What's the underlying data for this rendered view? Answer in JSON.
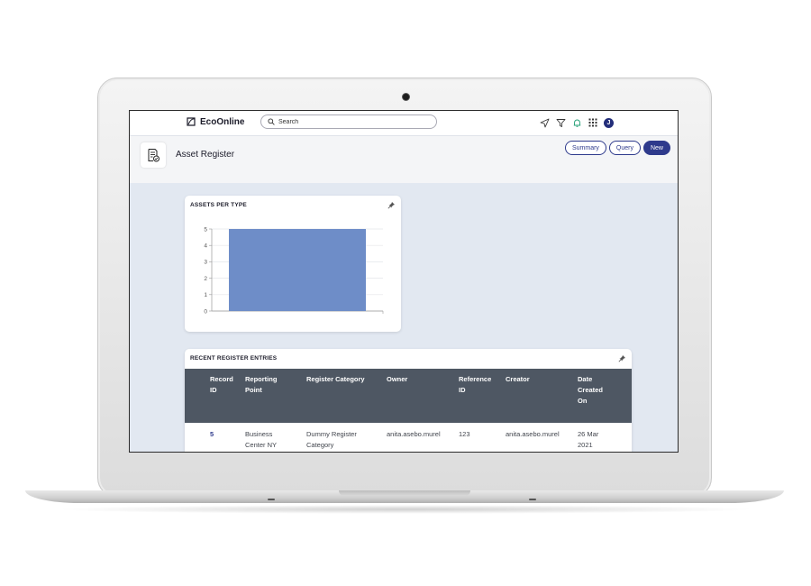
{
  "app": {
    "brand": "EcoOnline",
    "search_placeholder": "Search",
    "user_badge": "J"
  },
  "page": {
    "title": "Asset Register",
    "buttons": {
      "summary": "Summary",
      "query": "Query",
      "new": "New"
    }
  },
  "widgets": {
    "assets_per_type": {
      "title": "ASSETS PER TYPE",
      "chart_data": {
        "type": "bar",
        "categories": [
          ""
        ],
        "values": [
          5
        ],
        "yticks": [
          "0",
          "1",
          "2",
          "3",
          "4",
          "5"
        ],
        "ylim": [
          0,
          5
        ],
        "grid": true,
        "bar_color": "#6e8dc8"
      }
    },
    "recent_entries": {
      "title": "RECENT REGISTER ENTRIES",
      "columns": {
        "record_id": [
          "Record",
          "ID"
        ],
        "reporting_point": [
          "Reporting",
          "Point"
        ],
        "register_category": [
          "Register Category"
        ],
        "owner": [
          "Owner"
        ],
        "reference_id": [
          "Reference",
          "ID"
        ],
        "creator": [
          "Creator"
        ],
        "date_created": [
          "Date",
          "Created",
          "On"
        ]
      },
      "rows": [
        {
          "record_id": "5",
          "reporting_point": [
            "Business",
            "Center NY"
          ],
          "register_category": [
            "Dummy Register",
            "Category"
          ],
          "owner": "anita.asebo.murel",
          "reference_id": "123",
          "creator": "anita.asebo.murel",
          "date_created": [
            "26 Mar",
            "2021"
          ]
        }
      ]
    }
  },
  "colors": {
    "accent": "#2e3a8c",
    "table_header": "#4e5763",
    "content_bg": "#e2e8f1"
  }
}
